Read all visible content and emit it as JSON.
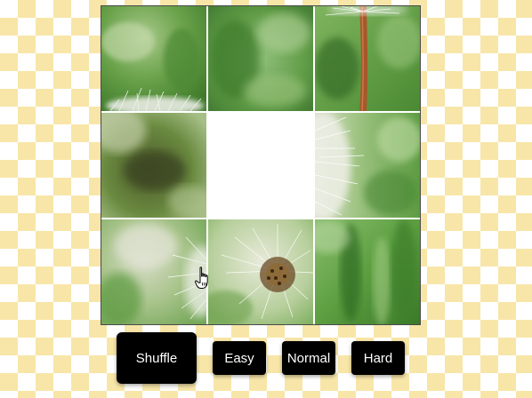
{
  "puzzle": {
    "grid_size": 3,
    "empty_tile_index": 4,
    "tiles": [
      {
        "name": "tile-0-0",
        "theme": "dandelion-seeds-bottom-left"
      },
      {
        "name": "tile-0-1",
        "theme": "blurred-green"
      },
      {
        "name": "tile-0-2",
        "theme": "dandelion-stem-top"
      },
      {
        "name": "tile-1-0",
        "theme": "dark-blurred-green"
      },
      {
        "name": "tile-1-1",
        "theme": "empty"
      },
      {
        "name": "tile-1-2",
        "theme": "dandelion-seeds-left-edge"
      },
      {
        "name": "tile-2-0",
        "theme": "light-blurred-with-seeds-right"
      },
      {
        "name": "tile-2-1",
        "theme": "dandelion-head-center"
      },
      {
        "name": "tile-2-2",
        "theme": "green-blades"
      }
    ]
  },
  "controls": {
    "shuffle_label": "Shuffle",
    "easy_label": "Easy",
    "normal_label": "Normal",
    "hard_label": "Hard"
  },
  "colors": {
    "checker_light": "#ffffff",
    "checker_dark": "#f8e6a8",
    "button_bg": "#000000",
    "button_text": "#ffffff",
    "board_border": "#4a4a4a"
  },
  "icons": {
    "cursor": "hand-pointer-icon"
  }
}
